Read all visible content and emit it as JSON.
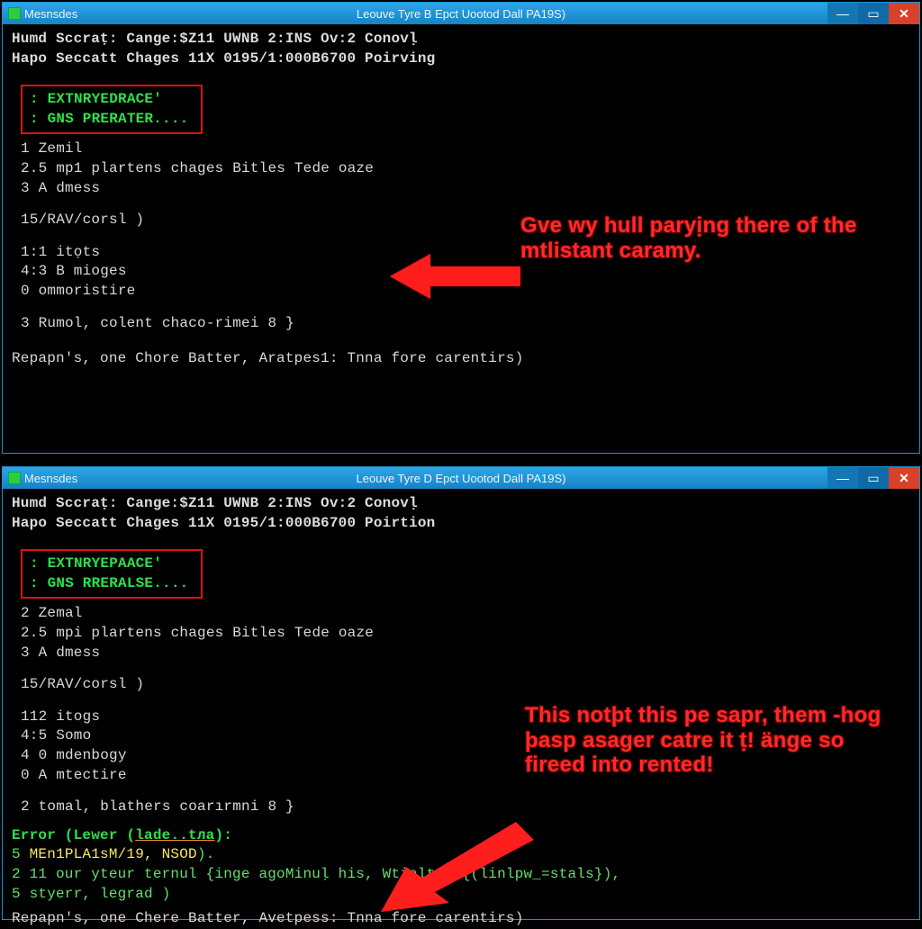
{
  "top": {
    "titlebar": {
      "app": "Mesnsdes",
      "title": "Leouve Tyre B Epct Uootod Dall PA19S)"
    },
    "header1": "Humd Sccraṭ: Cange:$Z11 UWNB 2:INS Ov:2 Conovḷ",
    "header2": "Hapo Seccatt Chages 11X 0195/1:000B6700 Poirving",
    "box1": ": EXTNRYEDRACE'",
    "box2": ": GNS PRERATER....",
    "l1": "1 Zemil",
    "l2": "2.5 mp1  plartens chages Bitles Tede oaze",
    "l3": "3 A dmess",
    "l4": "15/RAV/corsl )",
    "l5": "1:1 itọts",
    "l6": "4:3 B mioges",
    "l7": "0 ommoristire",
    "l8": "3 Rumol, colent chaco-rimei 8 }",
    "footer": "Repapn's, one Chore Batter, Aratpes1: Tnna fore carentirs)",
    "anno": "Gve wy hull paryịng there of the mtlistant caramy."
  },
  "bottom": {
    "titlebar": {
      "app": "Mesnsdes",
      "title": "Leouve Tyre D Epct Uootod Dall PA19S)"
    },
    "header1": "Humd Sccraṭ: Cange:$Z11 UWNB 2:INS Ov:2 Conovḷ",
    "header2": "Hapo Seccatt Chages 11X 0195/1:000B6700 Poirtion",
    "box1": ": EXTNRYEPAACE'",
    "box2": ": GNS RRERALSE....",
    "l1": "2 Zemal",
    "l2": "2.5 mpi  plartens chages Bitles Tede oaze",
    "l3": "3 A dmess",
    "l4": "15/RAV/corsl )",
    "l5": "112 itogs",
    "l6": "4:5 Somo",
    "l7": "4 0 mdenbogy",
    "l8": "0 A mtectire",
    "l9": "2 tomal, blathers coarırmni 8 }",
    "errhead_a": "Error (Lewer (",
    "errhead_b": "lade..tла",
    "errhead_c": "):",
    "err1a": "5 ",
    "err1b": "MEn1PLA1sM/19, NSOD",
    "err1c": ").",
    "err2": "2 11 our yteur ternul {inge agoMinuḷ his, Wtialt a {(linlpw_=stals}),",
    "err3": "5 styerr, legrad )",
    "footer": "Repapn's, one Chere Batter, Avetpess: Tnna fore carentirs)",
    "anno": "This notþt this pe sapr, them -hog þasp asager catre it ṭ! änge so fireed into rented!"
  }
}
